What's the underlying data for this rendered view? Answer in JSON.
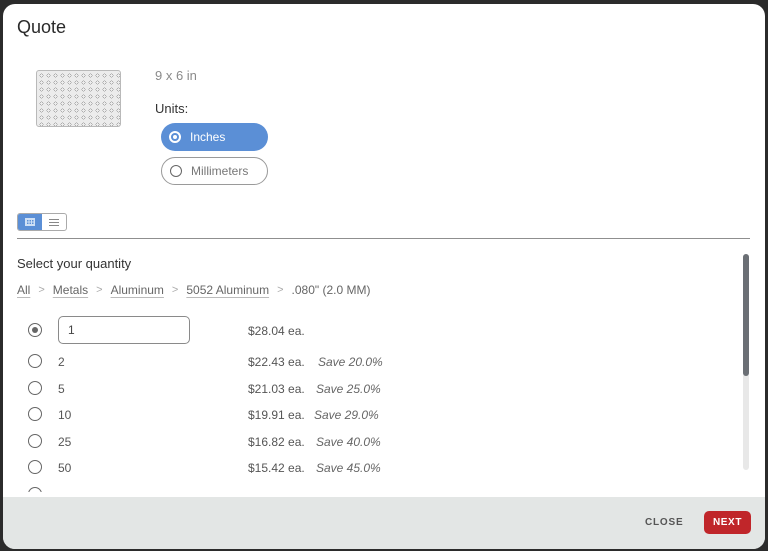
{
  "dialog": {
    "title": "Quote"
  },
  "part": {
    "thumbnail_icon": "perforated-sheet-thumbnail",
    "dimensions": "9 x 6 in"
  },
  "units": {
    "label": "Units:",
    "options": [
      {
        "label": "Inches",
        "selected": true
      },
      {
        "label": "Millimeters",
        "selected": false
      }
    ]
  },
  "view_toggle": {
    "options": [
      "grid-view",
      "list-view"
    ],
    "active": "grid-view"
  },
  "quantity": {
    "title": "Select your quantity",
    "breadcrumb": [
      {
        "label": "All"
      },
      {
        "label": "Metals"
      },
      {
        "label": "Aluminum"
      },
      {
        "label": "5052 Aluminum"
      },
      {
        "label": ".080\" (2.0 MM)"
      }
    ],
    "rows": [
      {
        "qty": "1",
        "price": "$28.04 ea.",
        "save": "",
        "selected": true,
        "editable": true
      },
      {
        "qty": "2",
        "price": "$22.43 ea.",
        "save": "Save 20.0%",
        "selected": false
      },
      {
        "qty": "5",
        "price": "$21.03 ea.",
        "save": "Save 25.0%",
        "selected": false
      },
      {
        "qty": "10",
        "price": "$19.91 ea.",
        "save": "Save 29.0%",
        "selected": false
      },
      {
        "qty": "25",
        "price": "$16.82 ea.",
        "save": "Save 40.0%",
        "selected": false
      },
      {
        "qty": "50",
        "price": "$15.42 ea.",
        "save": "Save 45.0%",
        "selected": false
      },
      {
        "qty": "",
        "price": "",
        "save": "",
        "selected": false
      }
    ]
  },
  "footer": {
    "close_label": "CLOSE",
    "next_label": "NEXT"
  },
  "colors": {
    "accent": "#5b8fd6",
    "primary_button": "#c0262a",
    "footer_bg": "#e3e6e5"
  }
}
